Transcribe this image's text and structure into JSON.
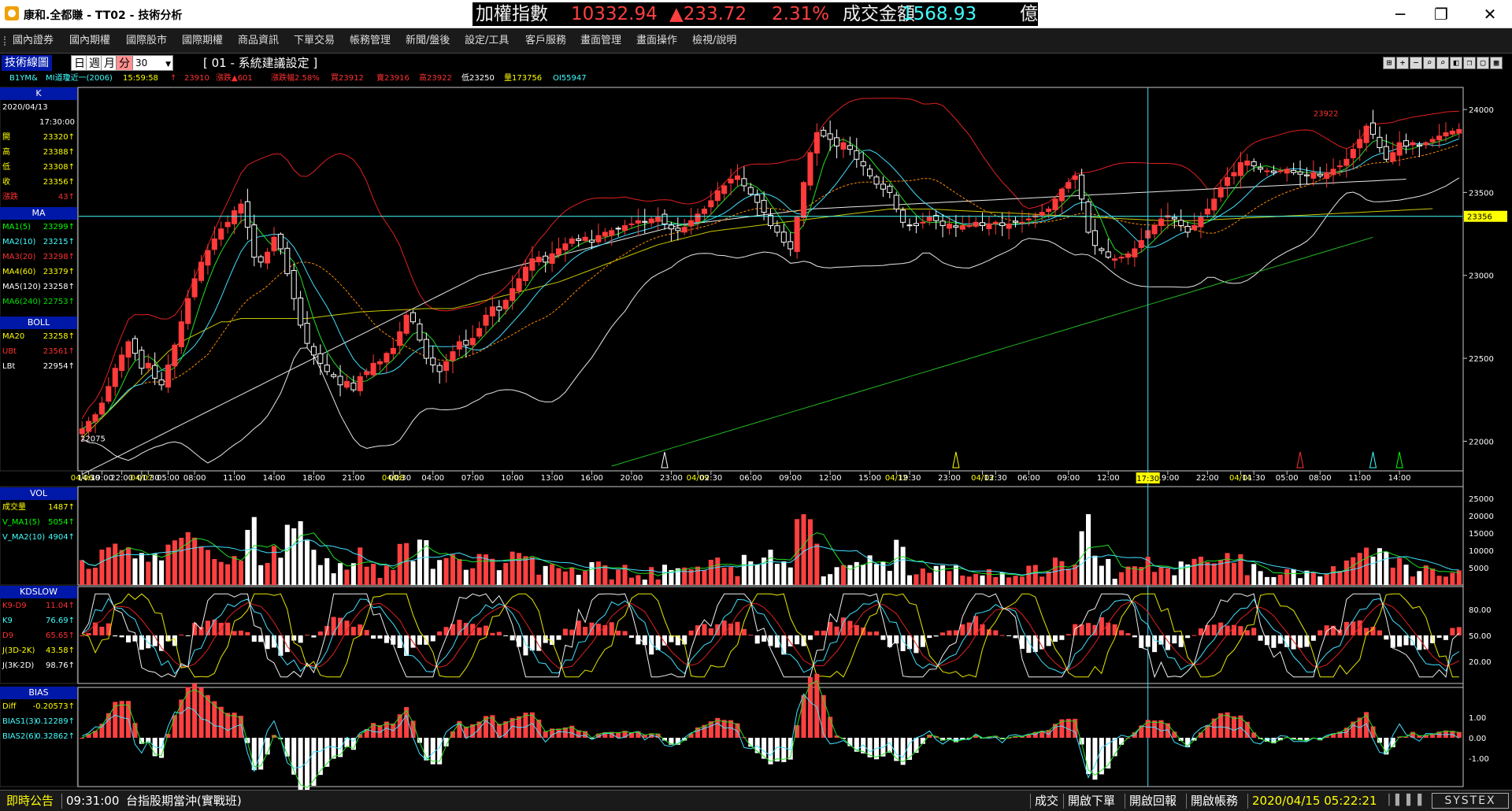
{
  "window": {
    "title": "康和.全都賺 - TT02 - 技術分析",
    "minimize_glyph": "─",
    "restore_glyph": "❐",
    "close_glyph": "✕"
  },
  "ticker": {
    "name": "加權指數",
    "value": "10332.94",
    "change": "▲233.72",
    "pct": "2.31%",
    "amount_label": "成交金額",
    "amount": "1568.93",
    "unit": "億",
    "colors": {
      "name": "#f0f0f0",
      "value": "#ff4040",
      "label": "#f0f0f0",
      "amount": "#40ffff"
    }
  },
  "menu": [
    "國內證券",
    "國內期權",
    "國際股市",
    "國際期權",
    "商品資訊",
    "下單交易",
    "帳務管理",
    "新聞/盤後",
    "設定/工具",
    "客戶服務",
    "畫面管理",
    "畫面操作",
    "檢視/說明"
  ],
  "toolbar": {
    "tech_label": "技術線圖",
    "periods": [
      "日",
      "週",
      "月",
      "分"
    ],
    "active_period": "分",
    "interval": "30",
    "system_setting": "[ 01 - 系統建議設定 ]",
    "tools": [
      "⊞",
      "+",
      "−",
      "⌕",
      "⌕",
      "◧",
      "❐",
      "▢",
      "▦"
    ]
  },
  "info": {
    "symbol": "B1YM&",
    "contract": "MI道瓊近一(2006)",
    "time": "15:59:58",
    "arrow": "↑",
    "price": "23910",
    "change": "漲跌▲601",
    "pct": "漲跌幅2.58%",
    "buy": "買23912",
    "sell": "賣23916",
    "high": "高23922",
    "low": "低23250",
    "volume": "量173756",
    "oi": "OI55947"
  },
  "panel_k": {
    "header": "K",
    "date": "2020/04/13",
    "time": "17:30:00",
    "rows": [
      {
        "k": "開",
        "v": "23320",
        "c": "#ffff00"
      },
      {
        "k": "高",
        "v": "23388",
        "c": "#ffff00"
      },
      {
        "k": "低",
        "v": "23308",
        "c": "#ffff00"
      },
      {
        "k": "收",
        "v": "23356",
        "c": "#ffff00"
      },
      {
        "k": "漲跌",
        "v": "43",
        "c": "#ff3030"
      }
    ]
  },
  "panel_ma": {
    "header": "MA",
    "rows": [
      {
        "k": "MA1(5)",
        "v": "23299",
        "c": "#00ff00"
      },
      {
        "k": "MA2(10)",
        "v": "23215",
        "c": "#40ffff"
      },
      {
        "k": "MA3(20)",
        "v": "23298",
        "c": "#ff3030"
      },
      {
        "k": "MA4(60)",
        "v": "23379",
        "c": "#ffff00"
      },
      {
        "k": "MA5(120)",
        "v": "23258",
        "c": "#ffffff"
      },
      {
        "k": "MA6(240)",
        "v": "22753",
        "c": "#00e000"
      }
    ]
  },
  "panel_boll": {
    "header": "BOLL",
    "rows": [
      {
        "k": "MA20",
        "v": "23258",
        "c": "#ffff00"
      },
      {
        "k": "UBt",
        "v": "23561",
        "c": "#ff3030"
      },
      {
        "k": "LBt",
        "v": "22954",
        "c": "#ffffff"
      }
    ]
  },
  "panel_vol": {
    "header": "VOL",
    "rows": [
      {
        "k": "成交量",
        "v": "1487",
        "c": "#ffff00"
      },
      {
        "k": "V_MA1(5)",
        "v": "5054",
        "c": "#00ff00"
      },
      {
        "k": "V_MA2(10)",
        "v": "4904",
        "c": "#40ffff"
      }
    ]
  },
  "panel_kd": {
    "header": "KDSLOW",
    "rows": [
      {
        "k": "K9-D9",
        "v": "11.04",
        "c": "#ff3030"
      },
      {
        "k": "K9",
        "v": "76.69",
        "c": "#40ffff"
      },
      {
        "k": "D9",
        "v": "65.65",
        "c": "#ff3030"
      },
      {
        "k": "J(3D-2K)",
        "v": "43.58",
        "c": "#ffff00"
      },
      {
        "k": "J(3K-2D)",
        "v": "98.76",
        "c": "#ffffff"
      }
    ]
  },
  "panel_bias": {
    "header": "BIAS",
    "rows": [
      {
        "k": "Diff",
        "v": "-0.20573",
        "c": "#ffff00"
      },
      {
        "k": "BIAS1(3)",
        "v": "0.12289",
        "c": "#40ffff"
      },
      {
        "k": "BIAS2(6)",
        "v": "0.32862",
        "c": "#40ffff"
      }
    ]
  },
  "chart_data": {
    "type": "candlestick",
    "price_axis": {
      "min": 21850,
      "max": 24100,
      "ticks": [
        24000,
        23500,
        23000,
        22500,
        22000
      ],
      "tick_labels": [
        "24000",
        "23500",
        "23000",
        "22500",
        "22000"
      ],
      "current": 23356,
      "current_label": "23356",
      "high_label": "23922",
      "low_label": "22075"
    },
    "time_labels": [
      {
        "i": 0,
        "t": "04/06",
        "date": true
      },
      {
        "i": 1,
        "t": "14:30"
      },
      {
        "i": 3,
        "t": "19:00"
      },
      {
        "i": 6,
        "t": "22:00"
      },
      {
        "i": 9,
        "t": "04/07",
        "date": true
      },
      {
        "i": 10,
        "t": "01:30"
      },
      {
        "i": 13,
        "t": "05:00"
      },
      {
        "i": 17,
        "t": "08:00"
      },
      {
        "i": 23,
        "t": "11:00"
      },
      {
        "i": 29,
        "t": "14:00"
      },
      {
        "i": 35,
        "t": "18:00"
      },
      {
        "i": 41,
        "t": "21:00"
      },
      {
        "i": 47,
        "t": "04/08",
        "date": true
      },
      {
        "i": 48,
        "t": "00:30"
      },
      {
        "i": 53,
        "t": "04:00"
      },
      {
        "i": 59,
        "t": "07:00"
      },
      {
        "i": 65,
        "t": "10:00"
      },
      {
        "i": 71,
        "t": "13:00"
      },
      {
        "i": 77,
        "t": "16:00"
      },
      {
        "i": 83,
        "t": "20:00"
      },
      {
        "i": 89,
        "t": "23:00"
      },
      {
        "i": 93,
        "t": "04/09",
        "date": true
      },
      {
        "i": 95,
        "t": "02:30"
      },
      {
        "i": 101,
        "t": "06:00"
      },
      {
        "i": 107,
        "t": "09:00"
      },
      {
        "i": 113,
        "t": "12:00"
      },
      {
        "i": 119,
        "t": "15:00"
      },
      {
        "i": 123,
        "t": "04/12",
        "date": true
      },
      {
        "i": 125,
        "t": "19:30"
      },
      {
        "i": 131,
        "t": "23:00"
      },
      {
        "i": 136,
        "t": "04/13",
        "date": true
      },
      {
        "i": 138,
        "t": "02:30"
      },
      {
        "i": 143,
        "t": "06:00"
      },
      {
        "i": 149,
        "t": "09:00"
      },
      {
        "i": 155,
        "t": "12:00"
      },
      {
        "i": 164,
        "t": "19:00"
      },
      {
        "i": 170,
        "t": "22:00"
      },
      {
        "i": 175,
        "t": "04/14",
        "date": true
      },
      {
        "i": 177,
        "t": "01:30"
      },
      {
        "i": 182,
        "t": "05:00"
      },
      {
        "i": 187,
        "t": "08:00"
      },
      {
        "i": 193,
        "t": "11:00"
      },
      {
        "i": 199,
        "t": "14:00"
      }
    ],
    "cursor": {
      "i": 161,
      "label": "17:30"
    },
    "closes": [
      22075,
      22120,
      22160,
      22230,
      22330,
      22440,
      22520,
      22600,
      22530,
      22440,
      22470,
      22380,
      22340,
      22460,
      22580,
      22720,
      22860,
      22980,
      23080,
      23150,
      23220,
      23280,
      23320,
      23390,
      23430,
      23290,
      23110,
      23080,
      23140,
      23230,
      23160,
      23010,
      22860,
      22700,
      22590,
      22520,
      22470,
      22420,
      22390,
      22340,
      22360,
      22310,
      22390,
      22420,
      22470,
      22480,
      22530,
      22560,
      22660,
      22760,
      22720,
      22610,
      22500,
      22460,
      22420,
      22480,
      22540,
      22600,
      22580,
      22620,
      22680,
      22760,
      22810,
      22790,
      22850,
      22920,
      22980,
      23050,
      23100,
      23110,
      23080,
      23130,
      23160,
      23190,
      23220,
      23210,
      23230,
      23200,
      23240,
      23260,
      23270,
      23280,
      23300,
      23310,
      23330,
      23320,
      23340,
      23350,
      23310,
      23280,
      23270,
      23290,
      23330,
      23370,
      23400,
      23450,
      23510,
      23540,
      23580,
      23600,
      23540,
      23490,
      23440,
      23380,
      23300,
      23260,
      23200,
      23160,
      23350,
      23560,
      23740,
      23860,
      23840,
      23820,
      23780,
      23800,
      23760,
      23700,
      23660,
      23600,
      23550,
      23520,
      23500,
      23400,
      23320,
      23300,
      23300,
      23320,
      23350,
      23330,
      23300,
      23310,
      23290,
      23300,
      23300,
      23320,
      23300,
      23310,
      23320,
      23300,
      23310,
      23320,
      23320,
      23340,
      23360,
      23380,
      23400,
      23460,
      23520,
      23560,
      23600,
      23460,
      23260,
      23180,
      23150,
      23110,
      23100,
      23110,
      23130,
      23160,
      23210,
      23270,
      23300,
      23340,
      23360,
      23340,
      23300,
      23260,
      23300,
      23350,
      23400,
      23460,
      23530,
      23590,
      23620,
      23680,
      23690,
      23660,
      23640,
      23630,
      23620,
      23630,
      23640,
      23620,
      23610,
      23600,
      23620,
      23600,
      23620,
      23640,
      23660,
      23700,
      23760,
      23820,
      23900,
      23850,
      23770,
      23700,
      23740,
      23800,
      23780,
      23800,
      23780,
      23800,
      23820,
      23840,
      23860,
      23870,
      23880
    ],
    "ma60": [
      22020,
      22060,
      22100,
      22140,
      22180,
      22220,
      22260,
      22300,
      22340,
      22380,
      22420,
      22460,
      22500,
      22540,
      22570,
      22600,
      22620,
      22640,
      22660,
      22680,
      22700,
      22720,
      22720,
      22730,
      22740,
      22740,
      22740,
      22740,
      22740,
      22740,
      22740,
      22740,
      22740,
      22740,
      22740,
      22745,
      22750,
      22755,
      22760,
      22765,
      22770,
      22775,
      22780,
      22782,
      22784,
      22786,
      22788,
      22790,
      22792,
      22794,
      22796,
      22798,
      22800,
      22800,
      22800,
      22800,
      22800,
      22810,
      22820,
      22830,
      22840,
      22850,
      22860,
      22870,
      22880,
      22890,
      22900,
      22910,
      22920,
      22930,
      22940,
      22950,
      22960,
      22975,
      22990,
      23005,
      23020,
      23035,
      23050,
      23065,
      23080,
      23095,
      23110,
      23125,
      23140,
      23155,
      23170,
      23185,
      23195,
      23205,
      23215,
      23225,
      23235,
      23245,
      23255,
      23265,
      23270,
      23275,
      23280,
      23285,
      23290,
      23295,
      23300,
      23305,
      23310,
      23315,
      23320,
      23325,
      23330,
      23335,
      23340,
      23345,
      23350,
      23355,
      23360,
      23365,
      23370,
      23375,
      23380,
      23385,
      23390,
      23395,
      23400,
      23400,
      23400,
      23400,
      23400,
      23400,
      23400,
      23398,
      23396,
      23394,
      23392,
      23390,
      23388,
      23386,
      23384,
      23382,
      23380,
      23378,
      23376,
      23374,
      23372,
      23370,
      23368,
      23366,
      23364,
      23362,
      23360,
      23358,
      23356,
      23354,
      23352,
      23350,
      23348,
      23346,
      23344,
      23342,
      23340,
      23338,
      23336,
      23334,
      23332,
      23330,
      23330,
      23330,
      23330,
      23330,
      23330,
      23332,
      23334,
      23336,
      23338,
      23340,
      23342,
      23344,
      23346,
      23348,
      23350,
      23352,
      23354,
      23356,
      23358,
      23360,
      23362,
      23364,
      23366,
      23368,
      23370,
      23372,
      23374,
      23376,
      23378,
      23380,
      23382,
      23384,
      23386,
      23388,
      23390,
      23392,
      23394,
      23396,
      23398,
      23400,
      23402
    ],
    "ma120": [
      21800,
      21820,
      21840,
      21860,
      21880,
      21900,
      21920,
      21940,
      21960,
      21980,
      22000,
      22020,
      22040,
      22060,
      22080,
      22100,
      22120,
      22140,
      22160,
      22180,
      22200,
      22220,
      22240,
      22260,
      22280,
      22300,
      22320,
      22340,
      22360,
      22380,
      22400,
      22420,
      22440,
      22460,
      22480,
      22500,
      22520,
      22540,
      22560,
      22580,
      22600,
      22620,
      22640,
      22660,
      22680,
      22700,
      22720,
      22740,
      22760,
      22780,
      22800,
      22820,
      22840,
      22860,
      22880,
      22900,
      22920,
      22940,
      22960,
      22980,
      23000,
      23010,
      23020,
      23030,
      23040,
      23050,
      23060,
      23070,
      23080,
      23090,
      23100,
      23110,
      23120,
      23130,
      23140,
      23150,
      23160,
      23170,
      23180,
      23190,
      23200,
      23210,
      23220,
      23230,
      23240,
      23250,
      23260,
      23270,
      23280,
      23290,
      23300,
      23305,
      23310,
      23315,
      23320,
      23325,
      23330,
      23335,
      23340,
      23345,
      23350,
      23355,
      23360,
      23365,
      23370,
      23375,
      23380,
      23385,
      23390,
      23395,
      23400,
      23402,
      23404,
      23406,
      23408,
      23410,
      23412,
      23414,
      23416,
      23418,
      23420,
      23422,
      23424,
      23426,
      23428,
      23430,
      23432,
      23434,
      23436,
      23438,
      23440,
      23442,
      23444,
      23446,
      23448,
      23450,
      23452,
      23454,
      23456,
      23458,
      23460,
      23462,
      23464,
      23466,
      23468,
      23470,
      23472,
      23474,
      23476,
      23478,
      23480,
      23482,
      23484,
      23486,
      23488,
      23490,
      23492,
      23494,
      23496,
      23498,
      23500,
      23502,
      23504,
      23506,
      23508,
      23510,
      23512,
      23514,
      23516,
      23518,
      23520,
      23522,
      23524,
      23526,
      23528,
      23530,
      23532,
      23534,
      23536,
      23538,
      23540,
      23542,
      23544,
      23546,
      23548,
      23550,
      23552,
      23554,
      23556,
      23558,
      23560,
      23562,
      23564,
      23566,
      23568,
      23570,
      23572,
      23574,
      23576,
      23578,
      23580
    ],
    "ma240": [
      null,
      null,
      null,
      null,
      null,
      null,
      null,
      null,
      null,
      null,
      null,
      null,
      null,
      null,
      null,
      null,
      null,
      null,
      null,
      null,
      null,
      null,
      null,
      null,
      null,
      null,
      null,
      null,
      null,
      null,
      null,
      null,
      null,
      null,
      null,
      null,
      null,
      null,
      null,
      null,
      null,
      null,
      null,
      null,
      null,
      null,
      null,
      null,
      null,
      null,
      null,
      null,
      null,
      null,
      null,
      null,
      null,
      null,
      null,
      null,
      null,
      null,
      null,
      null,
      null,
      null,
      null,
      null,
      null,
      null,
      null,
      null,
      null,
      null,
      null,
      null,
      null,
      null,
      null,
      null,
      21850,
      21862,
      21874,
      21886,
      21898,
      21910,
      21922,
      21934,
      21946,
      21958,
      21970,
      21982,
      21994,
      22006,
      22018,
      22030,
      22042,
      22054,
      22066,
      22078,
      22090,
      22102,
      22114,
      22126,
      22138,
      22150,
      22162,
      22174,
      22186,
      22198,
      22210,
      22222,
      22234,
      22246,
      22258,
      22270,
      22282,
      22294,
      22306,
      22318,
      22330,
      22342,
      22354,
      22366,
      22378,
      22390,
      22402,
      22414,
      22426,
      22438,
      22450,
      22462,
      22474,
      22486,
      22498,
      22510,
      22522,
      22534,
      22546,
      22558,
      22570,
      22582,
      22594,
      22606,
      22618,
      22630,
      22642,
      22654,
      22666,
      22678,
      22690,
      22702,
      22714,
      22726,
      22738,
      22750,
      22762,
      22774,
      22786,
      22798,
      22810,
      22822,
      22834,
      22846,
      22858,
      22870,
      22882,
      22894,
      22906,
      22918,
      22930,
      22942,
      22954,
      22966,
      22978,
      22990,
      23002,
      23014,
      23026,
      23038,
      23050,
      23062,
      23074,
      23086,
      23098,
      23110,
      23122,
      23134,
      23146,
      23158,
      23170,
      23182,
      23194,
      23206,
      23218,
      23230
    ],
    "vol_axis": {
      "max": 27000,
      "ticks": [
        25000,
        20000,
        15000,
        10000,
        5000
      ],
      "tick_labels": [
        "25000",
        "20000",
        "15000",
        "10000",
        "5000"
      ]
    },
    "kd_axis": {
      "ticks": [
        80,
        50,
        20
      ],
      "tick_labels": [
        "80.00",
        "50.00",
        "20.00"
      ]
    },
    "bias_axis": {
      "ticks": [
        1,
        0,
        -1
      ],
      "tick_labels": [
        "1.00",
        "0.00",
        "-1.00"
      ]
    },
    "markers": [
      {
        "i": 88,
        "color": "#ffffff"
      },
      {
        "i": 132,
        "color": "#ffff00"
      },
      {
        "i": 184,
        "color": "#ff3030"
      },
      {
        "i": 195,
        "color": "#40ffff"
      },
      {
        "i": 199,
        "color": "#00ff00"
      }
    ]
  },
  "status": {
    "label": "即時公告",
    "time": "09:31:00",
    "message": "台指股期當沖(實戰班)",
    "links": [
      "成交",
      "開啟下單",
      "開啟回報",
      "開啟帳務"
    ],
    "clock": "2020/04/15 05:22:21",
    "brand": "SYSTEX"
  }
}
